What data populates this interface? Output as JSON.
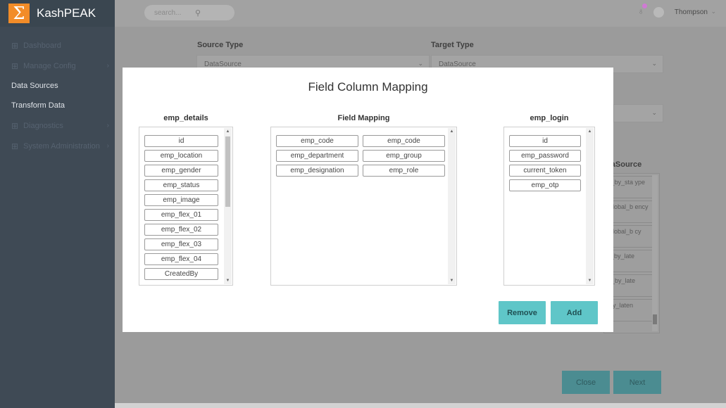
{
  "app": {
    "title": "KashPEAK",
    "logo_glyph": "Σ"
  },
  "sidebar": {
    "items": [
      {
        "label": "Dashboard",
        "has_chevron": false
      },
      {
        "label": "Manage Config",
        "has_chevron": true
      },
      {
        "label": "Data Sources",
        "sub": true
      },
      {
        "label": "Transform Data",
        "sub": true
      },
      {
        "label": "Diagnostics",
        "has_chevron": true
      },
      {
        "label": "System Administration",
        "has_chevron": true
      }
    ]
  },
  "topbar": {
    "search_placeholder": "search...",
    "user_name": "Thompson"
  },
  "form": {
    "source_type_label": "Source Type",
    "source_type_value": "DataSource",
    "target_type_label": "Target Type",
    "target_type_value": "DataSource",
    "datasource_header": "ataSource",
    "datasource_items": [
      "ry_by_sta ype",
      "_global_b ency",
      "_global_b cy",
      "st_by_late",
      "er_by_late",
      "_by_laten"
    ],
    "close_label": "Close",
    "next_label": "Next"
  },
  "modal": {
    "title": "Field Column Mapping",
    "left_title": "emp_details",
    "left_items": [
      "id",
      "emp_location",
      "emp_gender",
      "emp_status",
      "emp_image",
      "emp_flex_01",
      "emp_flex_02",
      "emp_flex_03",
      "emp_flex_04",
      "CreatedBy"
    ],
    "mapping_title": "Field Mapping",
    "mappings": [
      {
        "source": "emp_code",
        "target": "emp_code"
      },
      {
        "source": "emp_department",
        "target": "emp_group"
      },
      {
        "source": "emp_designation",
        "target": "emp_role"
      }
    ],
    "right_title": "emp_login",
    "right_items": [
      "id",
      "emp_password",
      "current_token",
      "emp_otp"
    ],
    "remove_label": "Remove",
    "add_label": "Add"
  },
  "colors": {
    "sidebar_bg": "#3f4a55",
    "accent": "#f28c28",
    "button_teal": "#5fc6c8"
  }
}
